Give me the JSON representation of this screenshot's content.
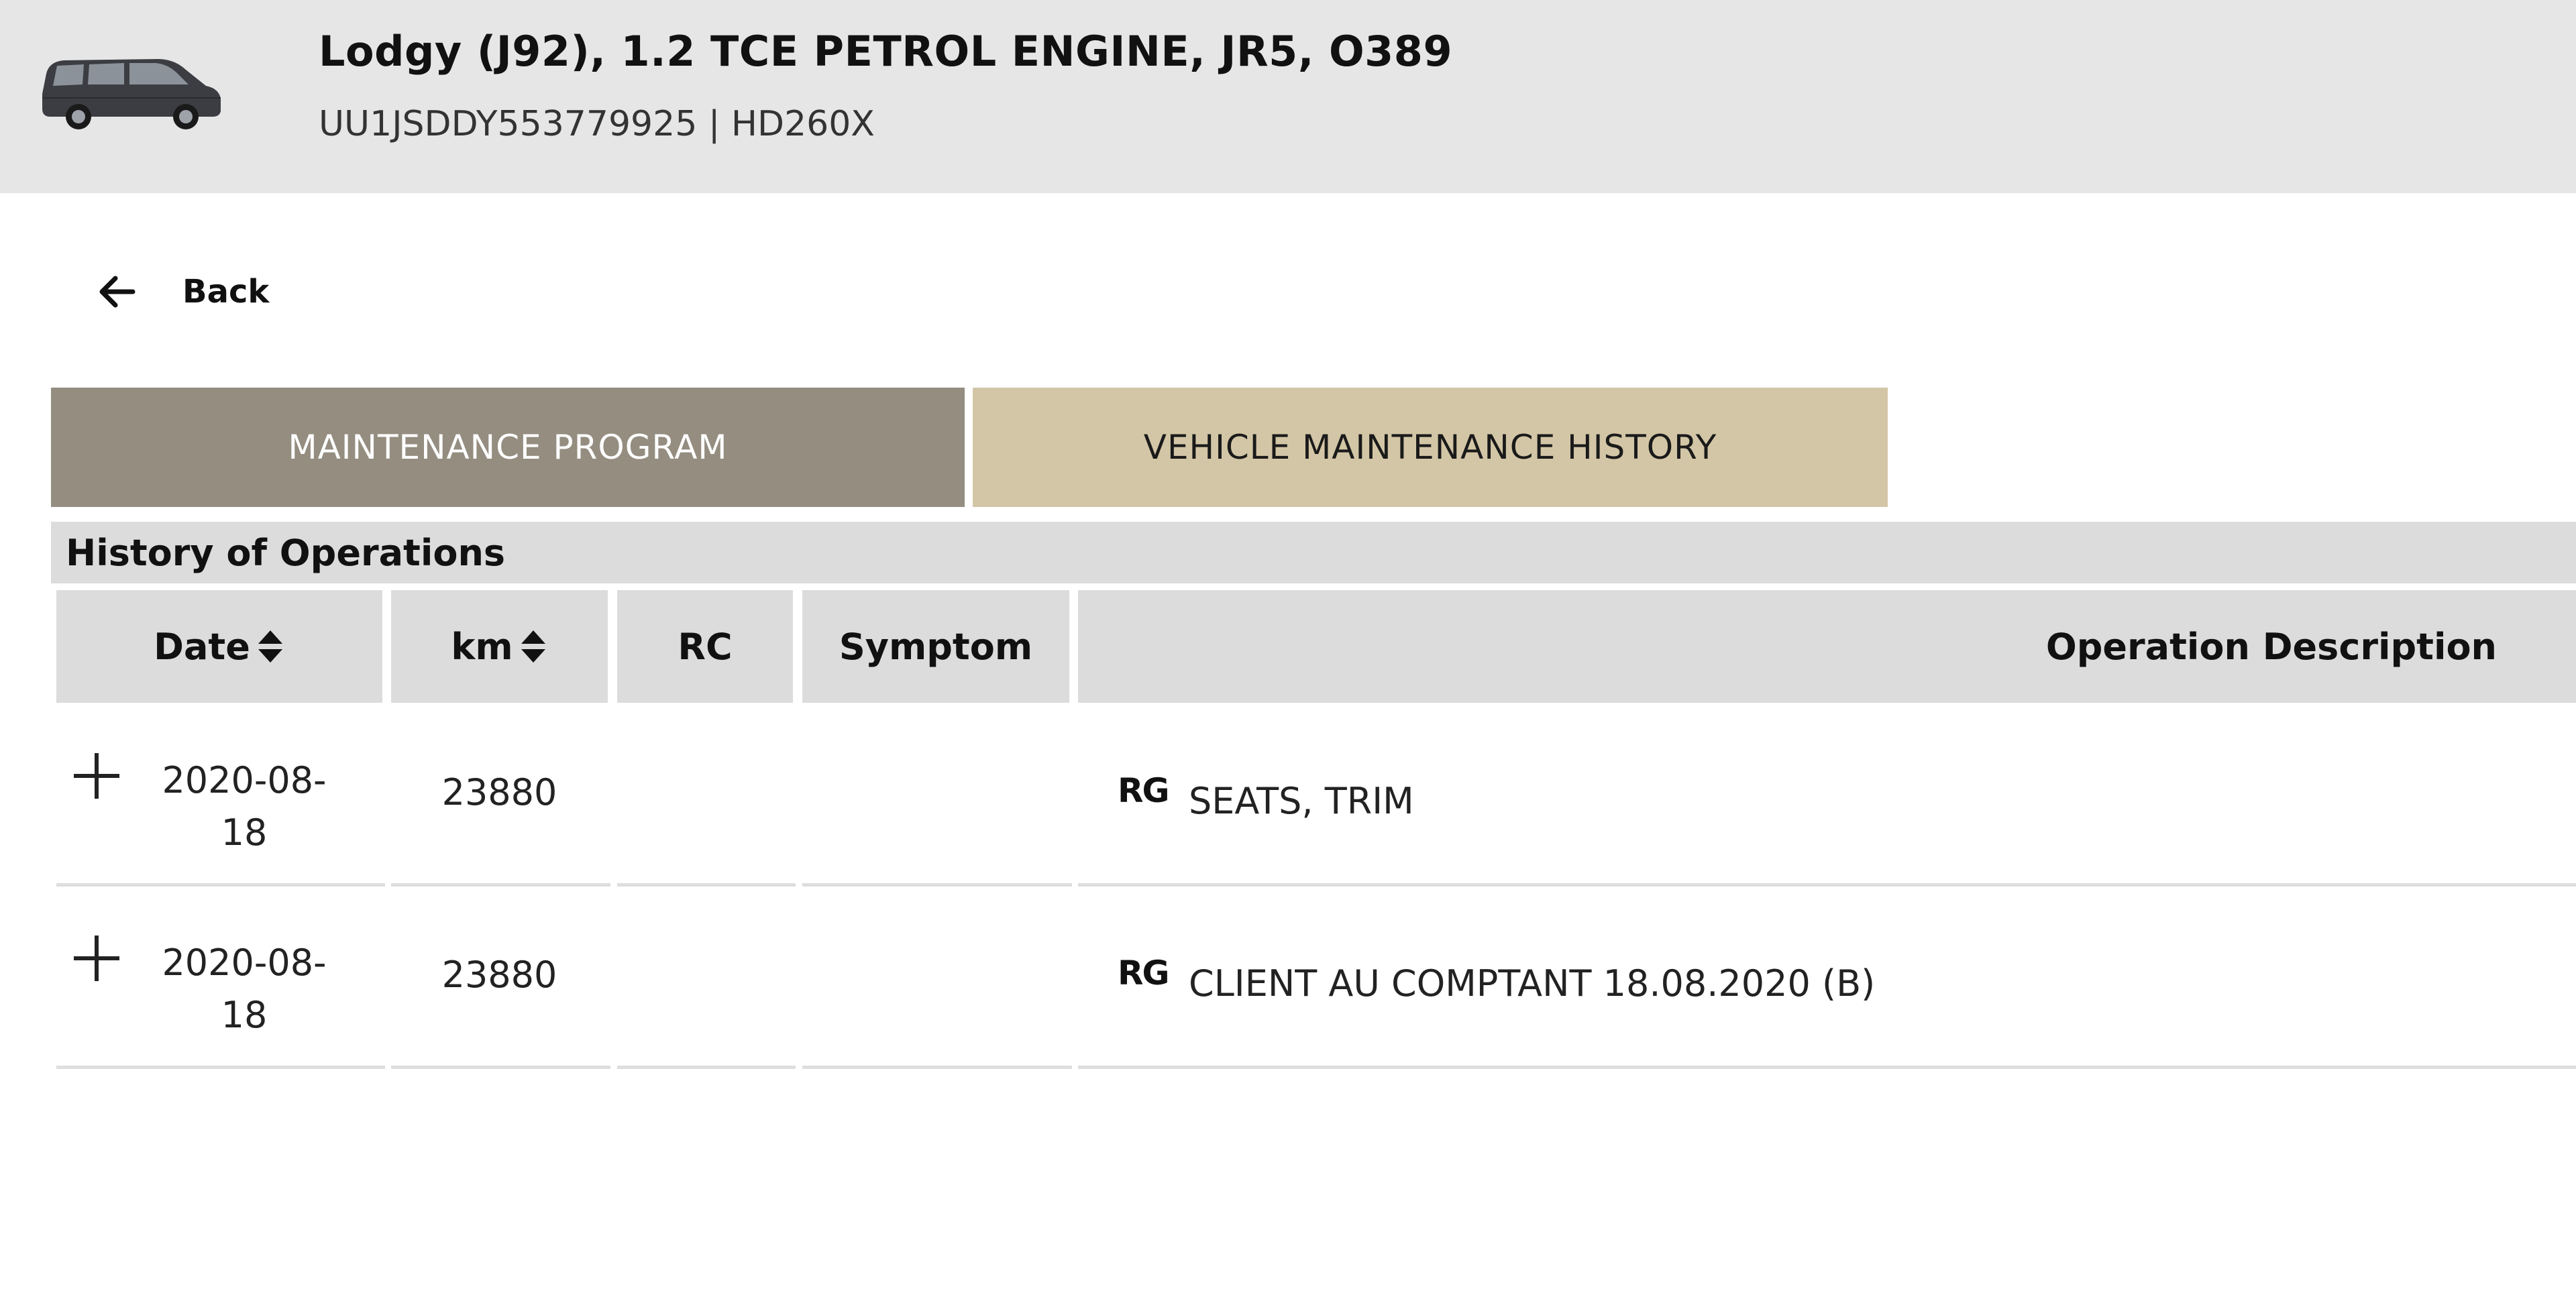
{
  "vehicle": {
    "title": "Lodgy (J92), 1.2 TCE PETROL ENGINE, JR5, O389",
    "subtitle": "UU1JSDDY553779925 | HD260X",
    "image_icon": "car-icon"
  },
  "nav": {
    "back_label": "Back",
    "back_icon": "arrow-left-icon"
  },
  "tabs": [
    {
      "label": "MAINTENANCE PROGRAM",
      "active": false
    },
    {
      "label": "VEHICLE MAINTENANCE HISTORY",
      "active": true
    }
  ],
  "section": {
    "title": "History of Operations"
  },
  "table": {
    "columns": [
      {
        "label": "Date",
        "sortable": true
      },
      {
        "label": "km",
        "sortable": true
      },
      {
        "label": "RC",
        "sortable": false
      },
      {
        "label": "Symptom",
        "sortable": false
      },
      {
        "label": "Operation Description",
        "sortable": false
      }
    ],
    "rows": [
      {
        "date_line1": "2020-08-",
        "date_line2": "18",
        "km": "23880",
        "rc": "",
        "symptom": "",
        "badge": "RG",
        "description": "SEATS, TRIM"
      },
      {
        "date_line1": "2020-08-",
        "date_line2": "18",
        "km": "23880",
        "rc": "",
        "symptom": "",
        "badge": "RG",
        "description": "CLIENT AU COMPTANT 18.08.2020 (B)"
      }
    ]
  },
  "colors": {
    "header_bg": "#e6e6e6",
    "tab_inactive_bg": "#948d80",
    "tab_active_bg": "#d3c6a6",
    "table_header_bg": "#dcdcdc"
  }
}
